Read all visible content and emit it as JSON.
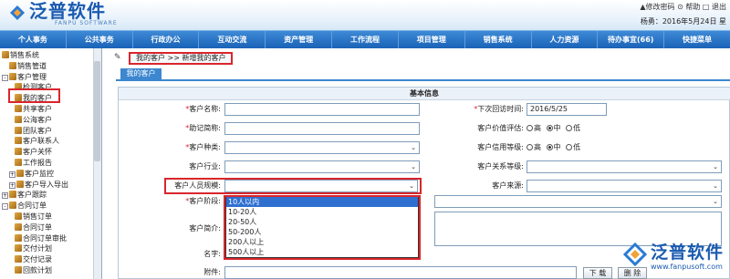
{
  "header": {
    "brand_cn": "泛普软件",
    "brand_en": "FANPU SOFTWARE",
    "toplinks": "▲修改密码 ⊙ 帮助 □ 退出",
    "user_line": "杨勇：2016年5月24日 星"
  },
  "nav": [
    "个人事务",
    "公共事务",
    "行政办公",
    "互动交流",
    "资产管理",
    "工作流程",
    "项目管理",
    "销售系统",
    "人力资源",
    "待办事宜(66)",
    "快捷菜单"
  ],
  "sidebar": {
    "items": [
      {
        "label": "销售系统",
        "level": 0,
        "expander": "",
        "icon": "gear-icon"
      },
      {
        "label": "销售管道",
        "level": 1,
        "expander": "",
        "icon": "folder-icon"
      },
      {
        "label": "客户管理",
        "level": 0,
        "expander": "-",
        "icon": "folder-icon"
      },
      {
        "label": "检测客户",
        "level": 2,
        "expander": "",
        "icon": "folder-icon"
      },
      {
        "label": "我的客户",
        "level": 2,
        "expander": "",
        "icon": "folder-icon"
      },
      {
        "label": "共享客户",
        "level": 2,
        "expander": "",
        "icon": "folder-icon"
      },
      {
        "label": "公海客户",
        "level": 2,
        "expander": "",
        "icon": "folder-icon"
      },
      {
        "label": "团队客户",
        "level": 2,
        "expander": "",
        "icon": "folder-icon"
      },
      {
        "label": "客户联系人",
        "level": 2,
        "expander": "",
        "icon": "folder-icon"
      },
      {
        "label": "客户关怀",
        "level": 2,
        "expander": "",
        "icon": "folder-icon"
      },
      {
        "label": "工作报告",
        "level": 2,
        "expander": "",
        "icon": "folder-icon"
      },
      {
        "label": "客户监控",
        "level": 1,
        "expander": "+",
        "icon": "folder-icon"
      },
      {
        "label": "客户导入导出",
        "level": 1,
        "expander": "+",
        "icon": "folder-icon"
      },
      {
        "label": "客户跟踪",
        "level": 0,
        "expander": "+",
        "icon": "folder-icon"
      },
      {
        "label": "合同订单",
        "level": 0,
        "expander": "-",
        "icon": "folder-icon"
      },
      {
        "label": "销售订单",
        "level": 2,
        "expander": "",
        "icon": "folder-icon"
      },
      {
        "label": "合同订单",
        "level": 2,
        "expander": "",
        "icon": "folder-icon"
      },
      {
        "label": "合同订单审批",
        "level": 2,
        "expander": "",
        "icon": "folder-icon"
      },
      {
        "label": "交付计划",
        "level": 2,
        "expander": "",
        "icon": "folder-icon"
      },
      {
        "label": "交付记录",
        "level": 2,
        "expander": "",
        "icon": "folder-icon"
      },
      {
        "label": "回款计划",
        "level": 2,
        "expander": "",
        "icon": "folder-icon"
      }
    ]
  },
  "breadcrumb": "我的客户 >> 新增我的客户",
  "tab": "我的客户",
  "form": {
    "title": "基本信息",
    "customer_name_label": "客户名称:",
    "next_visit_label": "下次回访时间:",
    "next_visit_value": "2016/5/25",
    "short_name_label": "助记简称:",
    "value_rating_label": "客户价值评估:",
    "kind_label": "客户种类:",
    "credit_label": "客户信用等级:",
    "industry_label": "客户行业:",
    "relation_label": "客户关系等级:",
    "staff_size_label": "客户人员规模:",
    "source_label": "客户来源:",
    "stage_label": "客户阶段:",
    "intro_label": "客户简介:",
    "name_label": "名字:",
    "attach_label": "附件:",
    "download_btn": "下 载",
    "delete_btn": "删 除",
    "rating_high": "高",
    "rating_mid": "中",
    "rating_low": "低",
    "rating_selected": "中",
    "staff_options": [
      "10人以内",
      "10-20人",
      "20-50人",
      "50-200人",
      "200人以上",
      "500人以上"
    ],
    "staff_highlighted": "10人以内"
  },
  "watermark": {
    "cn": "泛普软件",
    "url": "www.fanpusoft.com"
  },
  "colors": {
    "nav": "#1a63b8",
    "highlight": "#d9262c",
    "brand": "#1a5bb0"
  }
}
